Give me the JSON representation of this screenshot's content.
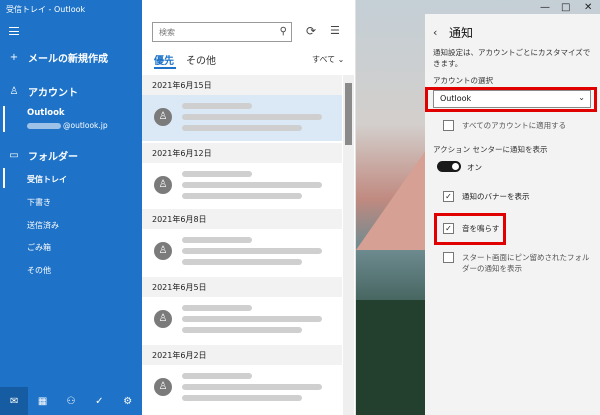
{
  "window": {
    "title": "受信トレイ - Outlook",
    "minimize": "—",
    "maximize": "□",
    "close": "✕"
  },
  "sidebar": {
    "new_mail": "メールの新規作成",
    "accounts_heading": "アカウント",
    "account_name": "Outlook",
    "account_email_suffix": "@outlook.jp",
    "folders_heading": "フォルダー",
    "folders": [
      "受信トレイ",
      "下書き",
      "送信済み",
      "ごみ箱",
      "その他"
    ]
  },
  "mail_list": {
    "search_placeholder": "検索",
    "tab_focused": "優先",
    "tab_other": "その他",
    "filter_label": "すべて ⌄",
    "date_groups": [
      "2021年6月15日",
      "2021年6月12日",
      "2021年6月8日",
      "2021年6月5日",
      "2021年6月2日"
    ]
  },
  "notifications": {
    "title": "通知",
    "description": "通知設定は、アカウントごとにカスタマイズできます。",
    "account_select_label": "アカウントの選択",
    "account_selected": "Outlook",
    "apply_all_label": "すべてのアカウントに適用する",
    "action_center_label": "アクション センターに通知を表示",
    "toggle_state": "オン",
    "banner_label": "通知のバナーを表示",
    "sound_label": "音を鳴らす",
    "pinned_label": "スタート画面にピン留めされたフォルダーの通知を表示"
  },
  "colors": {
    "accent": "#1e73c8",
    "highlight": "#e10000"
  }
}
